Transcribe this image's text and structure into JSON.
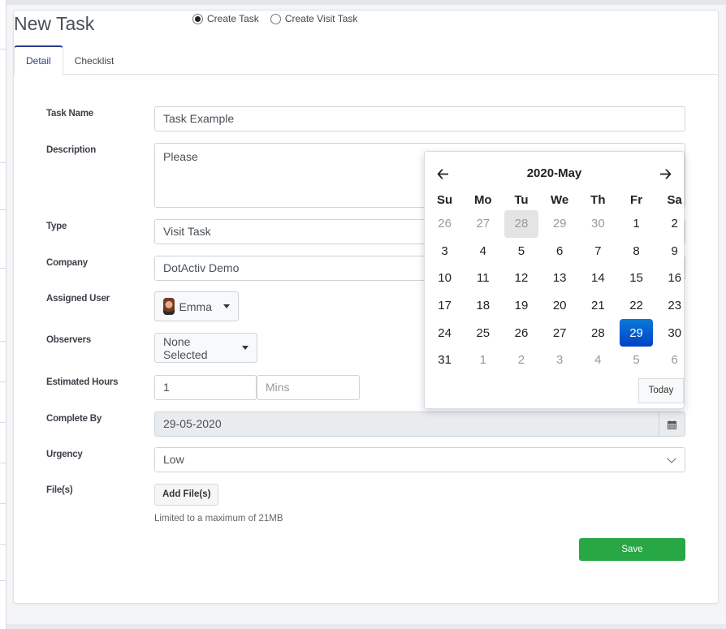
{
  "page": {
    "title": "New Task",
    "mode_options": [
      {
        "label": "Create Task",
        "checked": true
      },
      {
        "label": "Create Visit Task",
        "checked": false
      }
    ],
    "tabs": [
      {
        "label": "Detail",
        "active": true
      },
      {
        "label": "Checklist",
        "active": false
      }
    ]
  },
  "form": {
    "task_name": {
      "label": "Task Name",
      "value": "Task Example"
    },
    "description": {
      "label": "Description",
      "value": "Please"
    },
    "type": {
      "label": "Type",
      "value": "Visit Task"
    },
    "company": {
      "label": "Company",
      "value": "DotActiv Demo"
    },
    "assigned_user": {
      "label": "Assigned User",
      "value": "Emma",
      "icon": "user-avatar"
    },
    "observers": {
      "label": "Observers",
      "value": "None Selected"
    },
    "estimated_hours": {
      "label": "Estimated Hours",
      "hours_value": "1",
      "mins_placeholder": "Mins"
    },
    "complete_by": {
      "label": "Complete By",
      "value": "29-05-2020",
      "icon": "calendar-icon"
    },
    "urgency": {
      "label": "Urgency",
      "value": "Low"
    },
    "files": {
      "label": "File(s)",
      "button_label": "Add File(s)",
      "hint": "Limited to a maximum of 21MB"
    },
    "save_label": "Save",
    "save_color": "#28a745"
  },
  "datepicker": {
    "title": "2020-May",
    "prev_icon": "arrow-left",
    "next_icon": "arrow-right",
    "weekdays": [
      "Su",
      "Mo",
      "Tu",
      "We",
      "Th",
      "Fr",
      "Sa"
    ],
    "weeks": [
      [
        {
          "d": "26",
          "m": true
        },
        {
          "d": "27",
          "m": true
        },
        {
          "d": "28",
          "m": true,
          "today": true
        },
        {
          "d": "29",
          "m": true
        },
        {
          "d": "30",
          "m": true
        },
        {
          "d": "1"
        },
        {
          "d": "2"
        }
      ],
      [
        {
          "d": "3"
        },
        {
          "d": "4"
        },
        {
          "d": "5"
        },
        {
          "d": "6"
        },
        {
          "d": "7"
        },
        {
          "d": "8"
        },
        {
          "d": "9"
        }
      ],
      [
        {
          "d": "10"
        },
        {
          "d": "11"
        },
        {
          "d": "12"
        },
        {
          "d": "13"
        },
        {
          "d": "14"
        },
        {
          "d": "15"
        },
        {
          "d": "16"
        }
      ],
      [
        {
          "d": "17"
        },
        {
          "d": "18"
        },
        {
          "d": "19"
        },
        {
          "d": "20"
        },
        {
          "d": "21"
        },
        {
          "d": "22"
        },
        {
          "d": "23"
        }
      ],
      [
        {
          "d": "24"
        },
        {
          "d": "25"
        },
        {
          "d": "26"
        },
        {
          "d": "27"
        },
        {
          "d": "28"
        },
        {
          "d": "29",
          "selected": true
        },
        {
          "d": "30"
        }
      ],
      [
        {
          "d": "31"
        },
        {
          "d": "1",
          "m": true
        },
        {
          "d": "2",
          "m": true
        },
        {
          "d": "3",
          "m": true
        },
        {
          "d": "4",
          "m": true
        },
        {
          "d": "5",
          "m": true
        },
        {
          "d": "6",
          "m": true
        }
      ]
    ],
    "today_label": "Today",
    "selected_color": "#0055cc"
  }
}
